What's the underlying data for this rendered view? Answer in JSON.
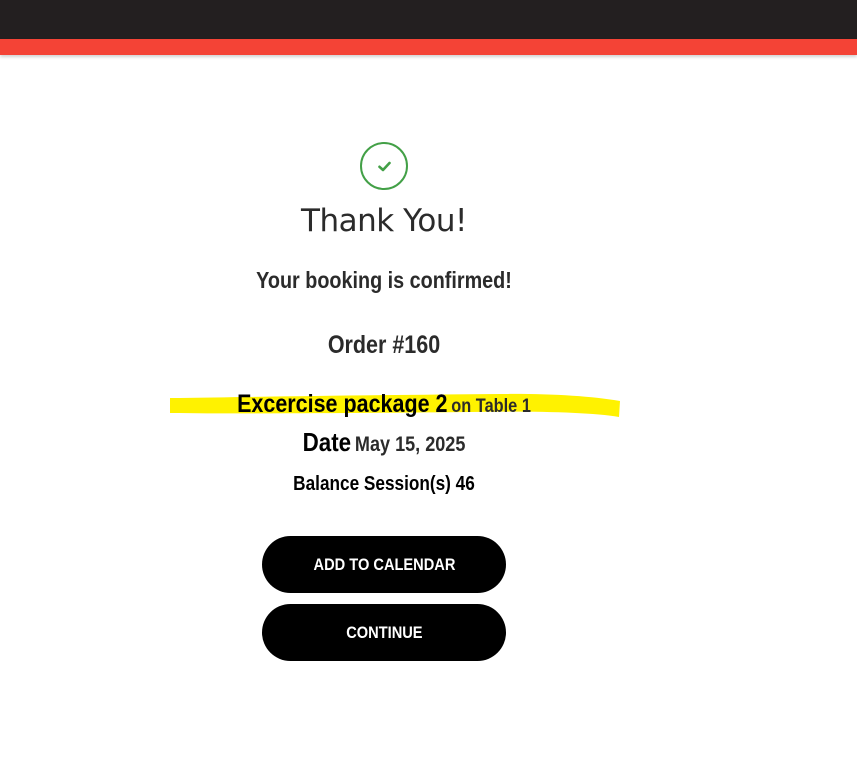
{
  "confirmation": {
    "icon": "check-icon",
    "title": "Thank You!",
    "message": "Your booking is confirmed!",
    "order_number": "Order #160",
    "package_name": "Excercise package 2",
    "table_info": "on Table 1",
    "date_label": "Date",
    "date_value": "May 15, 2025",
    "balance": "Balance Session(s) 46"
  },
  "actions": {
    "add_to_calendar_label": "ADD TO CALENDAR",
    "continue_label": "CONTINUE"
  },
  "colors": {
    "header_dark": "#231f20",
    "accent_red": "#f44336",
    "success_green": "#43a047",
    "highlight_yellow": "#fff200",
    "button_black": "#000000"
  }
}
